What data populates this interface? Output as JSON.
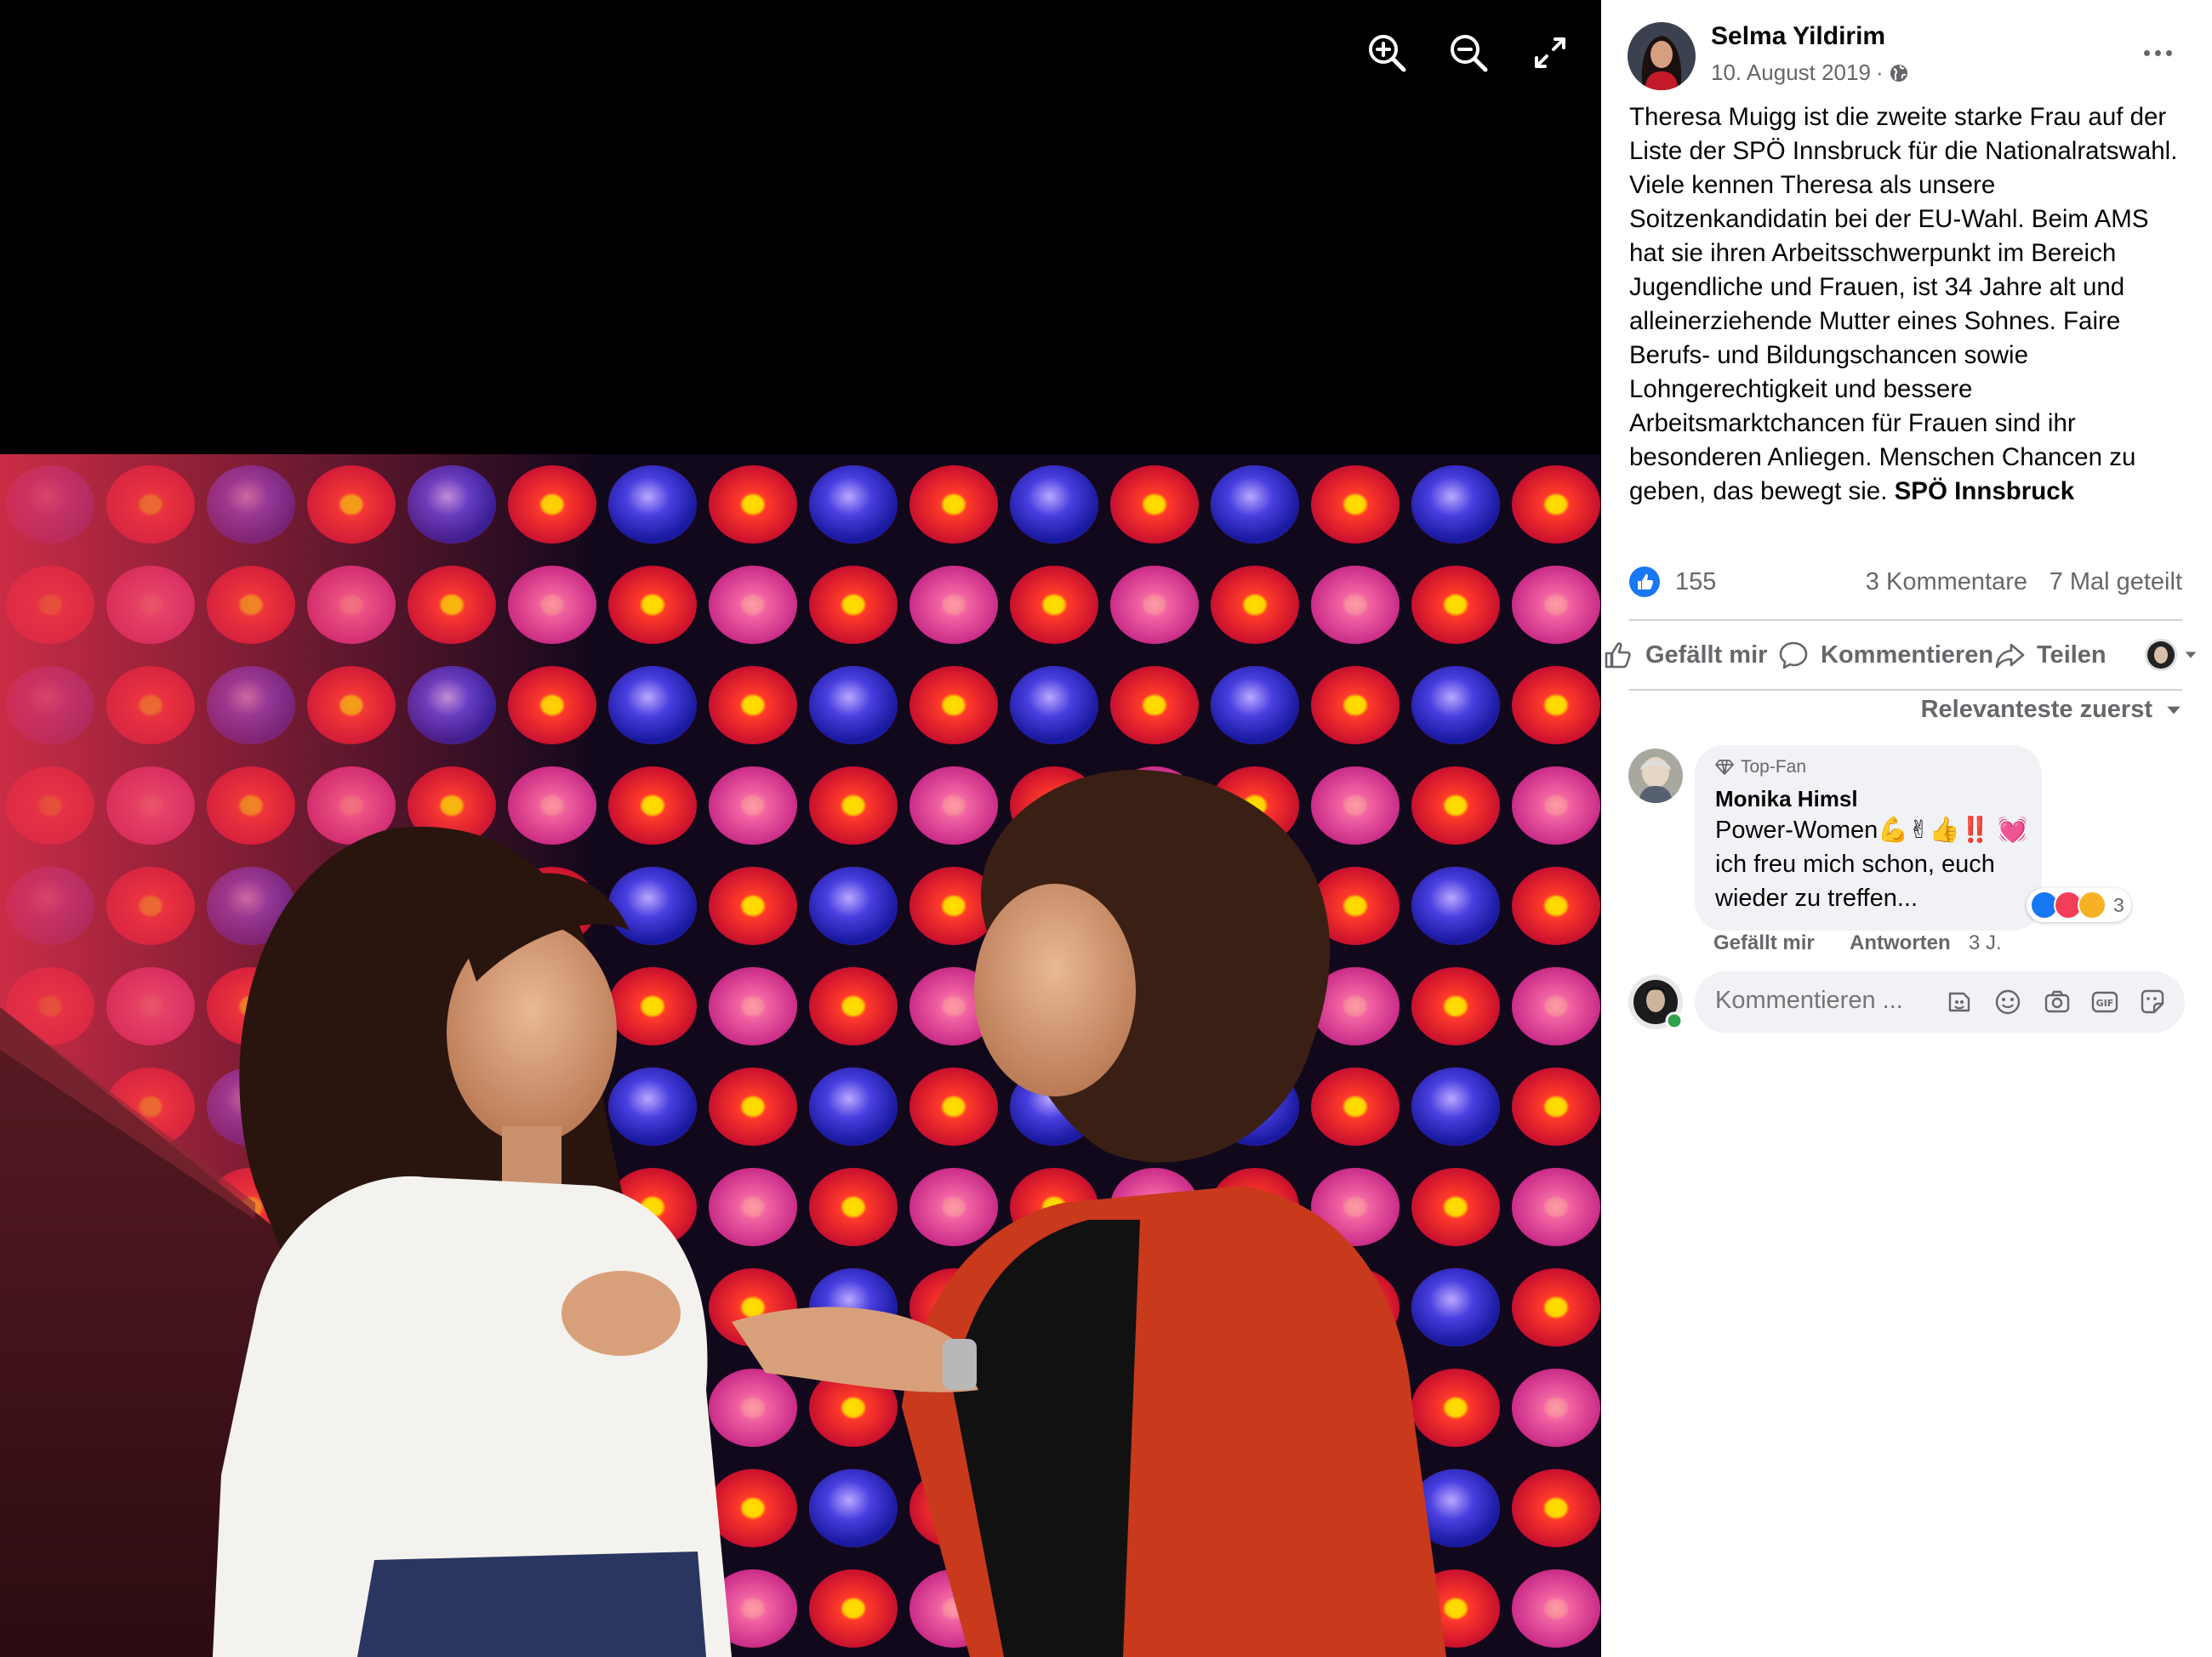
{
  "viewer": {
    "zoom_in_icon": "magnifier-plus-icon",
    "zoom_out_icon": "magnifier-minus-icon",
    "fullscreen_icon": "expand-arrows-icon"
  },
  "post": {
    "author": "Selma Yildirim",
    "date": "10. August 2019",
    "meta_separator": "·",
    "audience_icon": "globe-icon",
    "body": "Theresa Muigg ist die zweite starke Frau auf der Liste der SPÖ Innsbruck für die Nationalratswahl. Viele kennen Theresa als unsere Soitzenkandidatin bei der EU-Wahl. Beim AMS hat sie ihren Arbeitsschwerpunkt im Bereich Jugendliche und Frauen, ist 34 Jahre alt und alleinerziehende Mutter eines Sohnes. Faire Berufs- und Bildungschancen sowie Lohngerechtigkeit und bessere Arbeitsmarktchancen für Frauen sind ihr besonderen Anliegen. Menschen Chancen zu geben, das bewegt sie.",
    "tagged_page": "SPÖ Innsbruck"
  },
  "stats": {
    "likes": "155",
    "comments": "3 Kommentare",
    "shares": "7 Mal geteilt"
  },
  "actions": {
    "like": "Gefällt mir",
    "comment": "Kommentieren",
    "share": "Teilen"
  },
  "sort": {
    "label": "Relevanteste zuerst"
  },
  "comment": {
    "badge": "Top-Fan",
    "author": "Monika Himsl",
    "text": "Power-Women💪✌👍‼️ 💓 ich freu mich schon, euch wieder zu treffen...",
    "reaction_count": "3",
    "like_label": "Gefällt mir",
    "reply_label": "Antworten",
    "time": "3 J."
  },
  "composer": {
    "placeholder": "Kommentieren ...",
    "icons": [
      "avatar-sticker-icon",
      "emoji-icon",
      "camera-icon",
      "gif-icon",
      "sticker-icon"
    ]
  },
  "colors": {
    "accent": "#1877f2",
    "secondary_text": "#65676b",
    "bubble_bg": "#f0f2f5",
    "online": "#31a24c"
  }
}
